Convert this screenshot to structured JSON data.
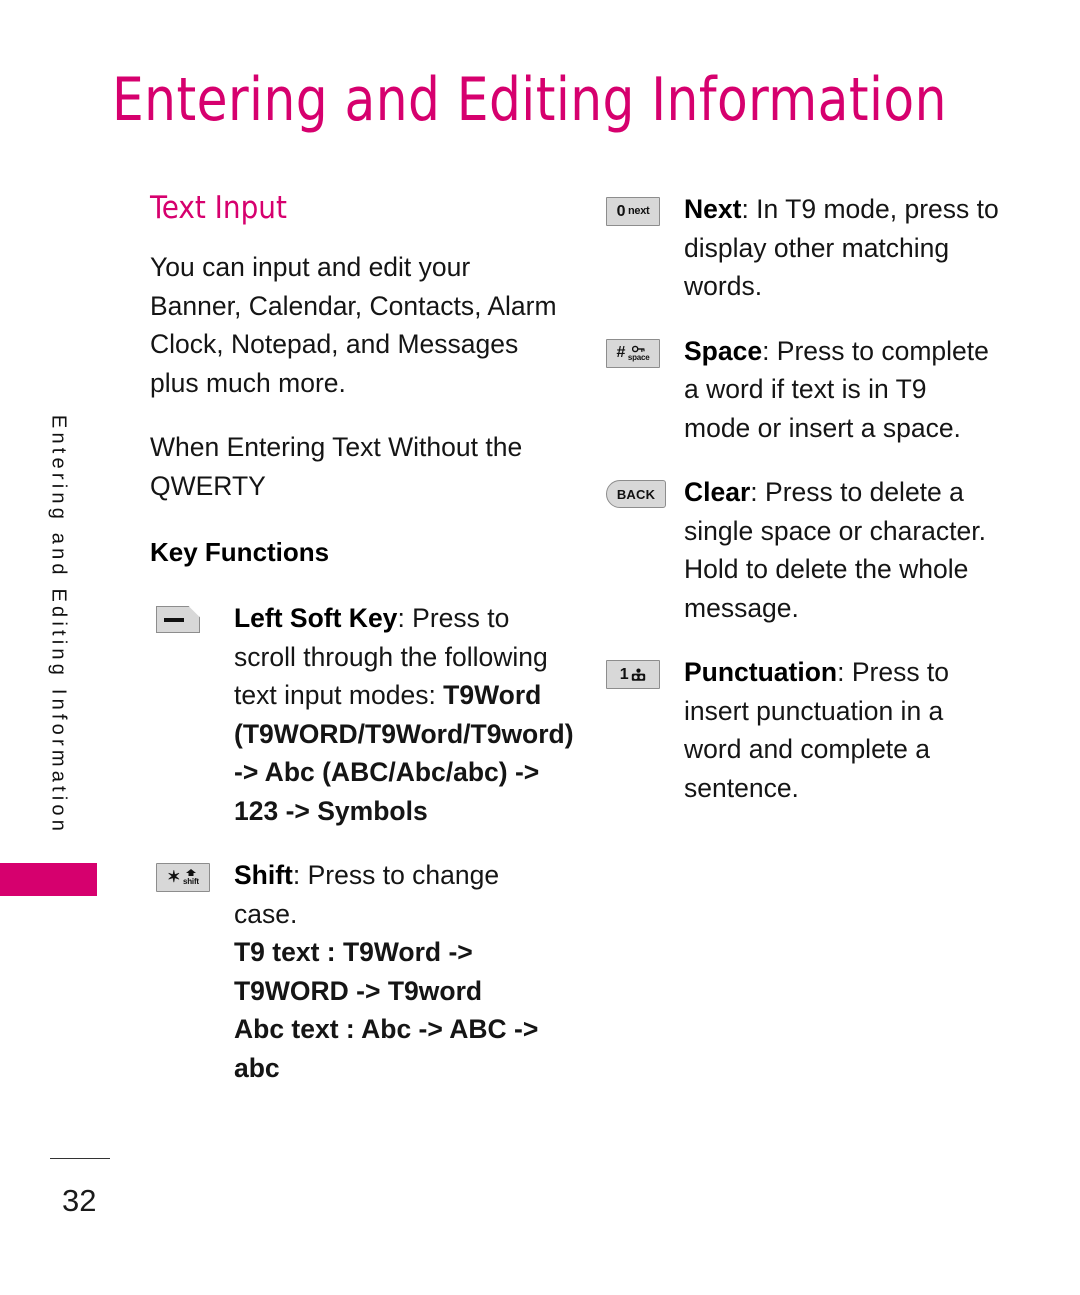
{
  "page": {
    "title": "Entering and Editing Information",
    "number": "32",
    "accent_color": "#D6006E",
    "side_tab_label": "Entering and Editing Information"
  },
  "left_column": {
    "section_heading": "Text Input",
    "intro_paragraph": "You can input and edit your Banner, Calendar, Contacts, Alarm Clock, Notepad, and Messages plus much more.",
    "qwerty_paragraph": "When Entering Text Without the QWERTY",
    "sub_heading": "Key Functions",
    "keys": [
      {
        "icon": "left-soft-key-icon",
        "icon_glyph": "—",
        "label": "Left Soft Key",
        "description": ": Press to scroll through the following text input modes: ",
        "bold_detail": "T9Word (T9WORD/T9Word/T9word) -> Abc (ABC/Abc/abc) -> 123 -> Symbols"
      },
      {
        "icon": "star-shift-key-icon",
        "icon_glyph": "✶",
        "icon_sub": "shift",
        "label": "Shift",
        "description": ": Press to change case.",
        "bold_detail": "T9 text : T9Word -> T9WORD -> T9word Abc text : Abc -> ABC -> abc",
        "bold_line_1": "T9 text : T9Word -> T9WORD -> T9word",
        "bold_line_2": "Abc text : Abc -> ABC -> abc"
      }
    ]
  },
  "right_column": {
    "keys": [
      {
        "icon": "zero-next-key-icon",
        "icon_main": "0",
        "icon_sub": "next",
        "label": "Next",
        "description": ": In T9 mode, press to display other matching words."
      },
      {
        "icon": "hash-space-key-icon",
        "icon_main": "#",
        "icon_sub": "space",
        "label": "Space",
        "description": ": Press to complete a word if text is in T9 mode or insert a space."
      },
      {
        "icon": "back-key-icon",
        "icon_main": "BACK",
        "label": "Clear",
        "description": ": Press to delete a single space or character. Hold to delete the whole message."
      },
      {
        "icon": "one-voicemail-key-icon",
        "icon_main": "1",
        "label": "Punctuation",
        "description": ": Press to insert punctuation in a word and complete a sentence."
      }
    ]
  }
}
